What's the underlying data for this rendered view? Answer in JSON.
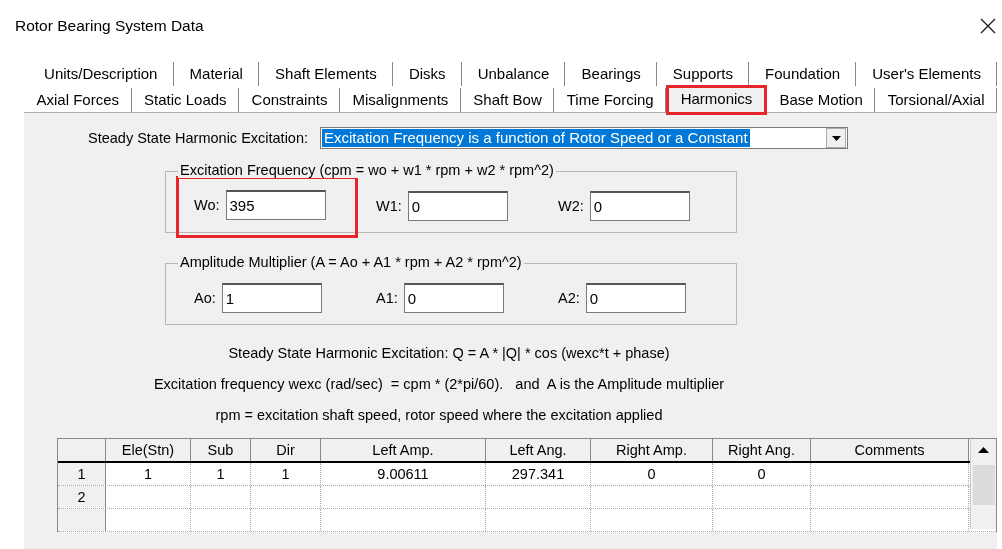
{
  "window": {
    "title": "Rotor Bearing System Data"
  },
  "tab_rows": [
    {
      "tabs": [
        {
          "label": "Units/Description",
          "selected": false,
          "highlighted": false
        },
        {
          "label": "Material",
          "selected": false,
          "highlighted": false
        },
        {
          "label": "Shaft Elements",
          "selected": false,
          "highlighted": false
        },
        {
          "label": "Disks",
          "selected": false,
          "highlighted": false
        },
        {
          "label": "Unbalance",
          "selected": false,
          "highlighted": false
        },
        {
          "label": "Bearings",
          "selected": false,
          "highlighted": false
        },
        {
          "label": "Supports",
          "selected": false,
          "highlighted": false
        },
        {
          "label": "Foundation",
          "selected": false,
          "highlighted": false
        },
        {
          "label": "User's Elements",
          "selected": false,
          "highlighted": false
        }
      ]
    },
    {
      "tabs": [
        {
          "label": "Axial Forces",
          "selected": false,
          "highlighted": false
        },
        {
          "label": "Static Loads",
          "selected": false,
          "highlighted": false
        },
        {
          "label": "Constraints",
          "selected": false,
          "highlighted": false
        },
        {
          "label": "Misalignments",
          "selected": false,
          "highlighted": false
        },
        {
          "label": "Shaft Bow",
          "selected": false,
          "highlighted": false
        },
        {
          "label": "Time Forcing",
          "selected": false,
          "highlighted": false
        },
        {
          "label": "Harmonics",
          "selected": true,
          "highlighted": true
        },
        {
          "label": "Base Motion",
          "selected": false,
          "highlighted": false
        },
        {
          "label": "Torsional/Axial",
          "selected": false,
          "highlighted": false
        }
      ]
    }
  ],
  "excitation": {
    "label": "Steady State Harmonic Excitation:",
    "value": "Excitation Frequency is a function of Rotor Speed or a Constant"
  },
  "groups": [
    {
      "title": "Excitation Frequency (cpm = wo + w1 * rpm + w2 * rpm^2)",
      "fields": [
        {
          "label": "Wo:",
          "value": "395",
          "highlighted": true
        },
        {
          "label": "W1:",
          "value": "0",
          "highlighted": false
        },
        {
          "label": "W2:",
          "value": "0",
          "highlighted": false
        }
      ]
    },
    {
      "title": "Amplitude Multiplier (A = Ao + A1 * rpm + A2 * rpm^2)",
      "fields": [
        {
          "label": "Ao:",
          "value": "1",
          "highlighted": false
        },
        {
          "label": "A1:",
          "value": "0",
          "highlighted": false
        },
        {
          "label": "A2:",
          "value": "0",
          "highlighted": false
        }
      ]
    }
  ],
  "notes": [
    "Steady State Harmonic Excitation: Q = A * |Q| * cos (wexc*t + phase)",
    "Excitation frequency wexc (rad/sec)  = cpm * (2*pi/60).   and  A is the Amplitude multiplier",
    "rpm = excitation shaft speed, rotor speed where the excitation applied"
  ],
  "table": {
    "columns": [
      "Ele(Stn)",
      "Sub",
      "Dir",
      "Left Amp.",
      "Left Ang.",
      "Right Amp.",
      "Right Ang.",
      "Comments"
    ],
    "rows": [
      {
        "number": "1",
        "cells": [
          "1",
          "1",
          "1",
          "9.00611",
          "297.341",
          "0",
          "0"
        ]
      },
      {
        "number": "2",
        "cells": []
      }
    ]
  }
}
